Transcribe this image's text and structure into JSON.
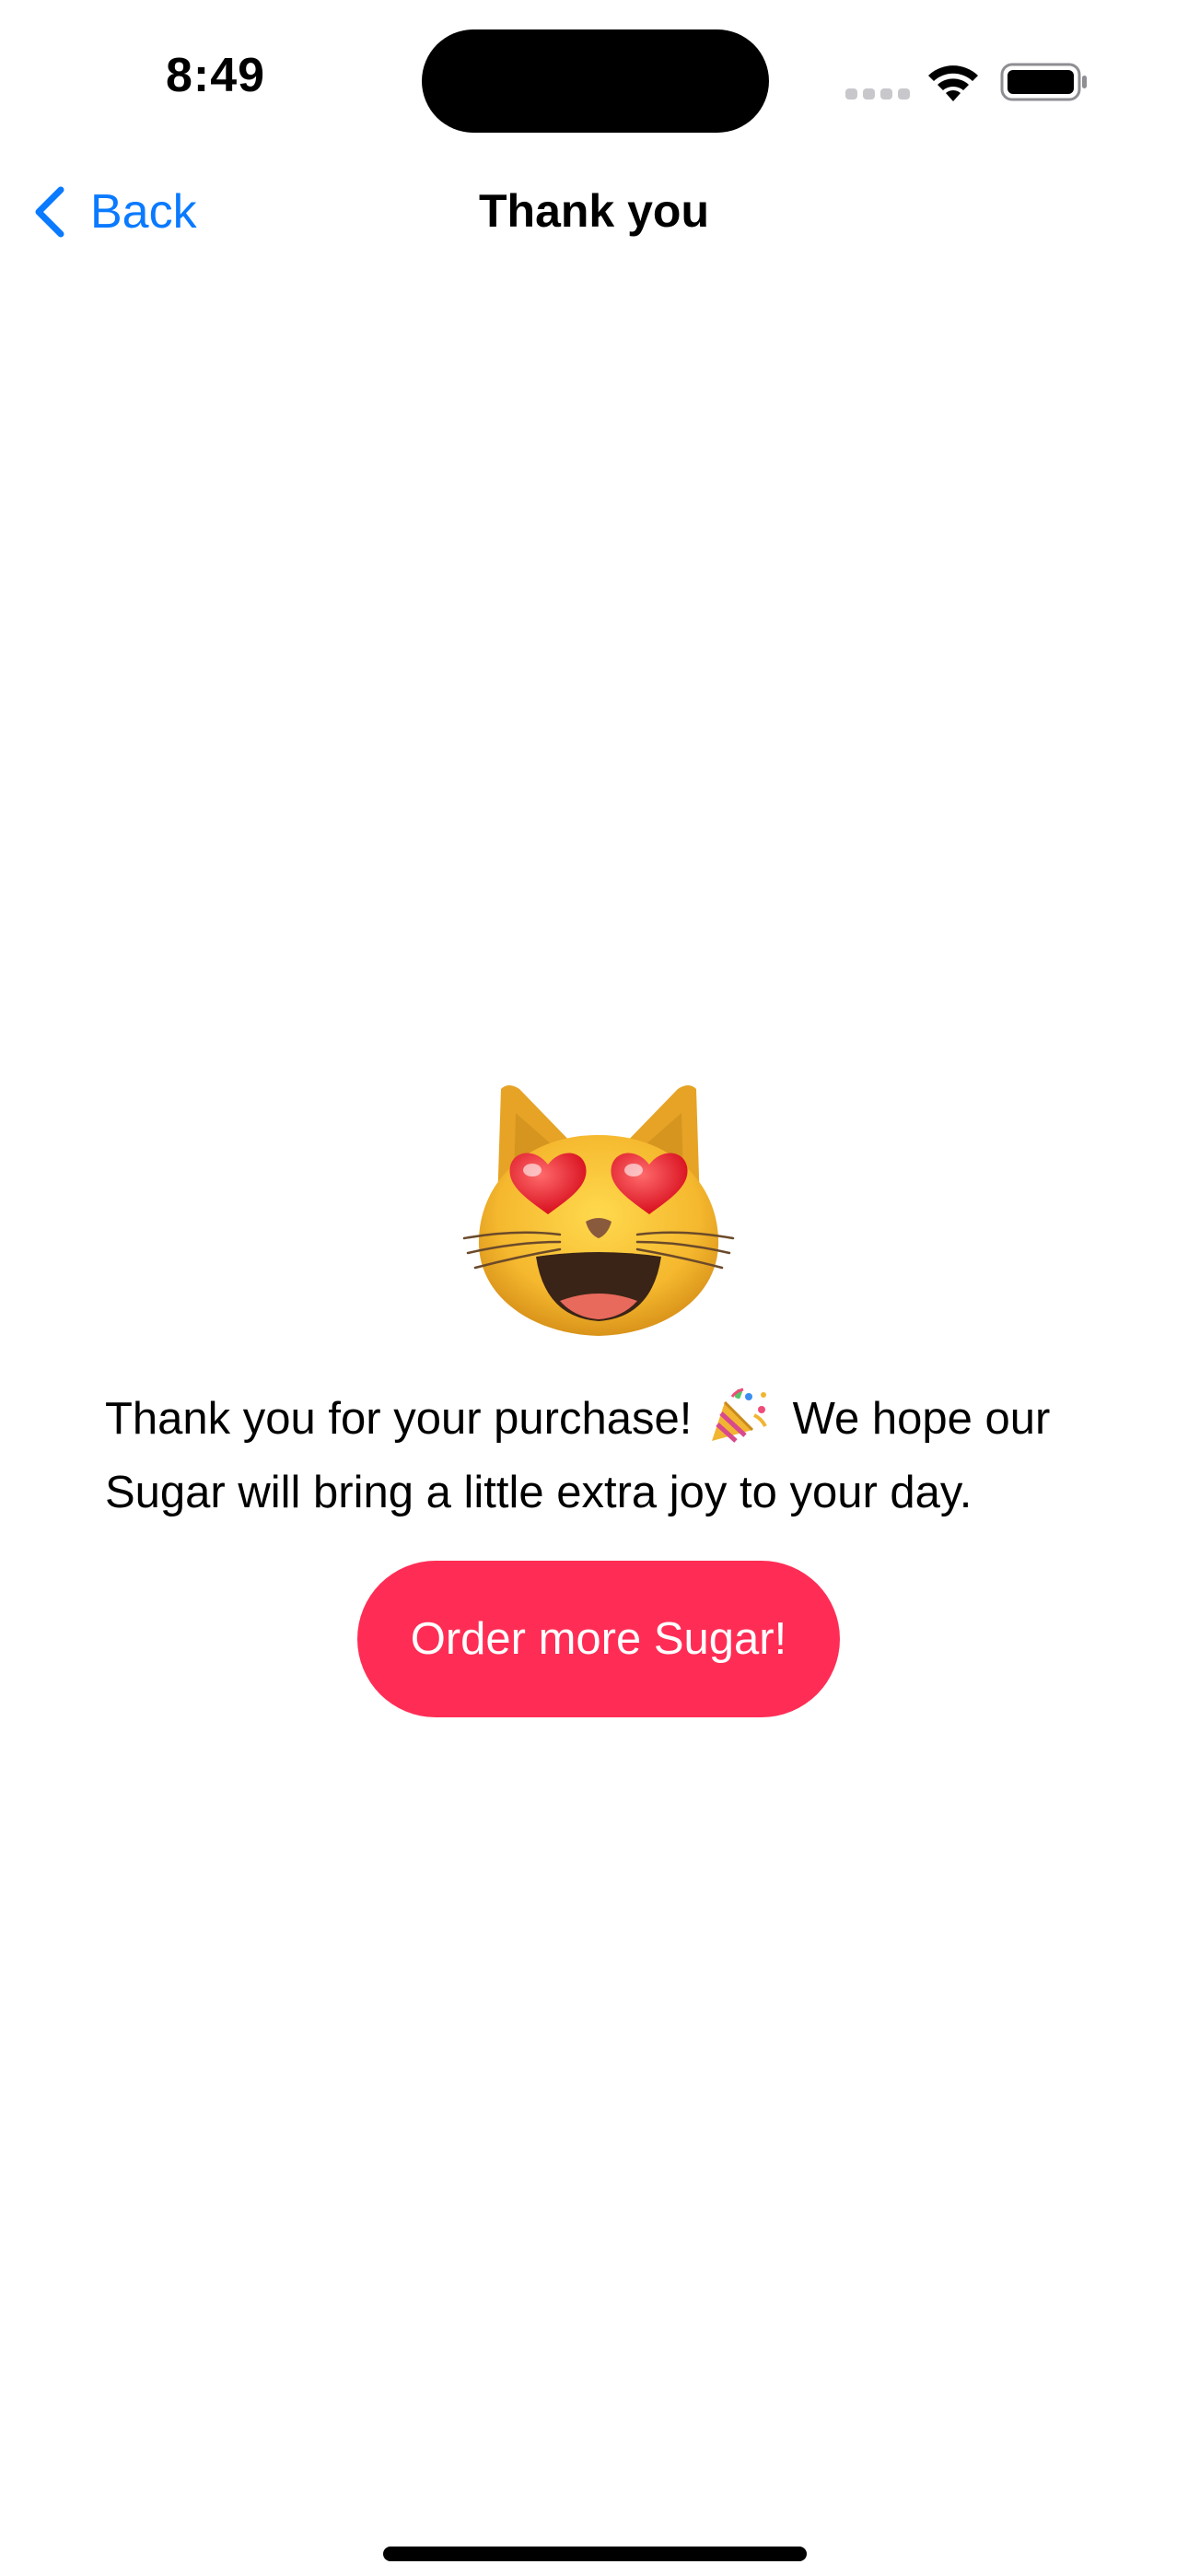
{
  "status_bar": {
    "time": "8:49",
    "icons": [
      "cellular-signal-icon",
      "wifi-icon",
      "battery-icon"
    ]
  },
  "nav": {
    "back_label": "Back",
    "title": "Thank you",
    "back_icon": "chevron-left-icon"
  },
  "content": {
    "emoji_icon": "smiling-cat-with-heart-eyes-icon",
    "message_part1": "Thank you for your purchase!",
    "message_icon": "party-popper-icon",
    "message_part2": "We hope our Sugar will bring a little extra joy to your day.",
    "order_button_label": "Order more Sugar!"
  },
  "colors": {
    "accent_blue": "#0a7aff",
    "button_pink": "#ff2d55",
    "background": "#ffffff"
  }
}
